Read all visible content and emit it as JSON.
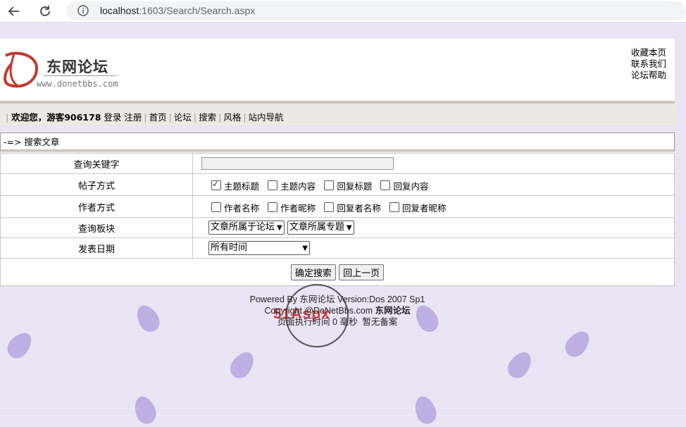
{
  "browser": {
    "url_host": "localhost",
    "url_path": ":1603/Search/Search.aspx"
  },
  "header": {
    "logo_title": "东网论坛",
    "logo_url": "www.donetbbs.com",
    "links": [
      "收藏本页",
      "联系我们",
      "论坛帮助"
    ]
  },
  "nav": {
    "welcome": "欢迎您，游客906178",
    "items": [
      "登录",
      "注册",
      "首页",
      "论坛",
      "搜索",
      "风格",
      "站内导航"
    ]
  },
  "breadcrumb": "-=> 搜索文章",
  "form": {
    "keyword_label": "查询关键字",
    "keyword_value": "",
    "post_label": "帖子方式",
    "post_options": [
      {
        "label": "主题标题",
        "checked": true
      },
      {
        "label": "主题内容",
        "checked": false
      },
      {
        "label": "回复标题",
        "checked": false
      },
      {
        "label": "回复内容",
        "checked": false
      }
    ],
    "author_label": "作者方式",
    "author_options": [
      {
        "label": "作者名称",
        "checked": false
      },
      {
        "label": "作者昵称",
        "checked": false
      },
      {
        "label": "回复者名称",
        "checked": false
      },
      {
        "label": "回复者昵称",
        "checked": false
      }
    ],
    "board_label": "查询板块",
    "board_select": "文章所属于论坛",
    "topic_select": "文章所属专题",
    "date_label": "发表日期",
    "date_select": "所有时间",
    "submit_label": "确定搜索",
    "back_label": "回上一页"
  },
  "footer": {
    "powered": "Powered By 东网论坛 Version:Dos 2007 Sp1",
    "copyright_prefix": "Copyright @DoNetBbs.com",
    "copyright_brand": "东网论坛",
    "exec": "页面执行时间 0 毫秒",
    "icp": "暂无备案",
    "watermark": "51Aspx"
  }
}
